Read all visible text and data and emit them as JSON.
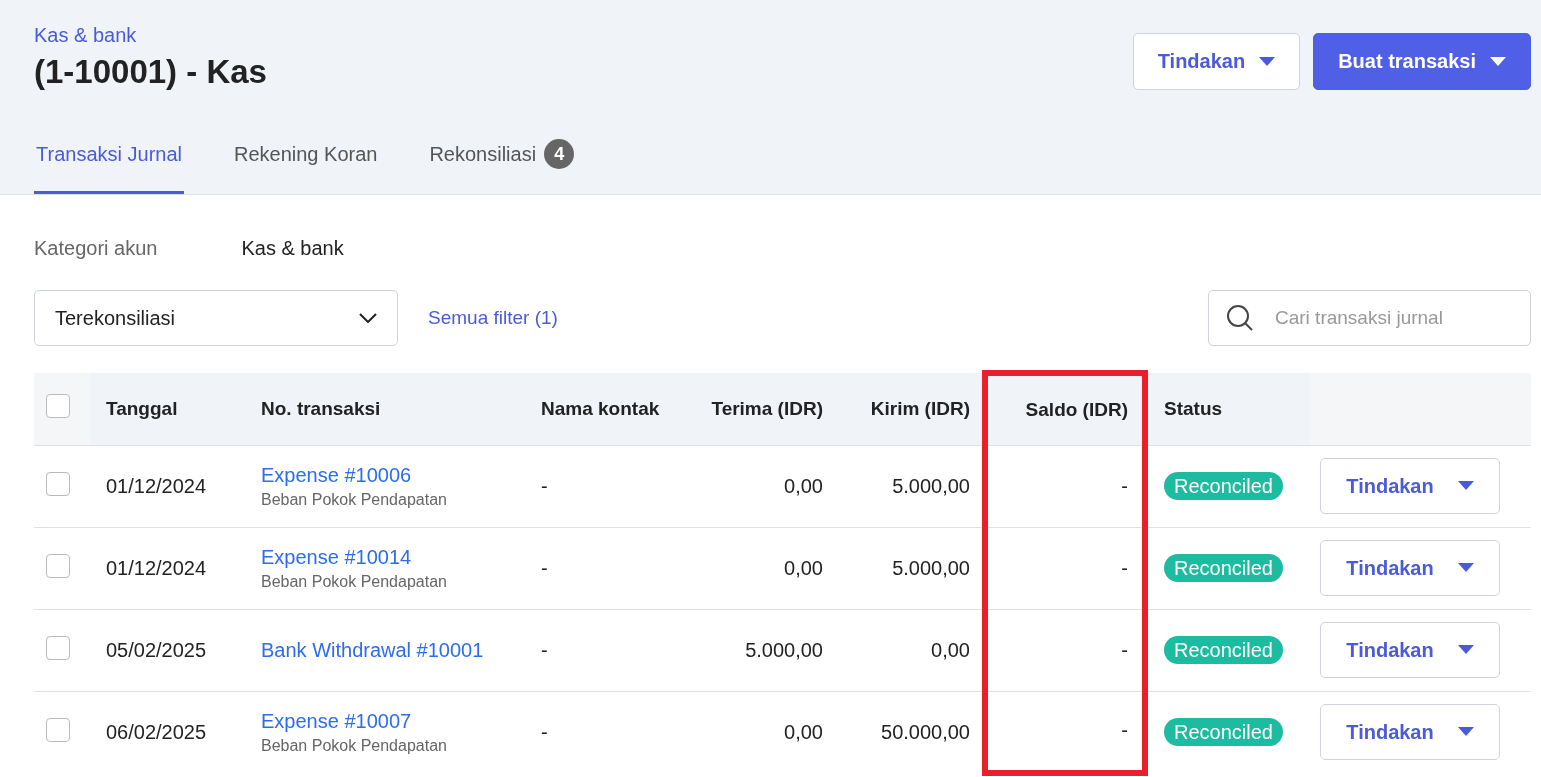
{
  "breadcrumb": "Kas & bank",
  "title": "(1-10001) - Kas",
  "header_buttons": [
    {
      "label": "Tindakan",
      "kind": "secondary"
    },
    {
      "label": "Buat transaksi",
      "kind": "primary"
    }
  ],
  "tabs": [
    {
      "label": "Transaksi Jurnal",
      "selected": true
    },
    {
      "label": "Rekening Koran",
      "selected": false
    },
    {
      "label": "Rekonsiliasi",
      "selected": false,
      "badge": "4"
    }
  ],
  "account_category": {
    "label": "Kategori akun",
    "value": "Kas & bank"
  },
  "filter": {
    "value": "Terekonsiliasi",
    "link": "Semua filter (1)"
  },
  "search": {
    "placeholder": "Cari transaksi jurnal"
  },
  "table": {
    "select_all_checked": false,
    "columns": [
      {
        "label": "Tanggal",
        "highlighted": false
      },
      {
        "label": "No. transaksi",
        "highlighted": false
      },
      {
        "label": "Nama kontak",
        "highlighted": false
      },
      {
        "label": "Terima (IDR)",
        "highlighted": false
      },
      {
        "label": "Kirim (IDR)",
        "highlighted": false
      },
      {
        "label": "Saldo (IDR)",
        "highlighted": true
      },
      {
        "label": "Status",
        "highlighted": false
      }
    ],
    "rows": [
      {
        "checked": false,
        "date": "01/12/2024",
        "number": "Expense #10006",
        "account": "Beban Pokok Pendapatan",
        "contact": "-",
        "receive": "0,00",
        "send": "5.000,00",
        "balance": "-",
        "status": "Reconciled",
        "action": "Tindakan"
      },
      {
        "checked": false,
        "date": "01/12/2024",
        "number": "Expense #10014",
        "account": "Beban Pokok Pendapatan",
        "contact": "-",
        "receive": "0,00",
        "send": "5.000,00",
        "balance": "-",
        "status": "Reconciled",
        "action": "Tindakan"
      },
      {
        "checked": false,
        "date": "05/02/2025",
        "number": "Bank Withdrawal #10001",
        "contact": "-",
        "receive": "5.000,00",
        "send": "0,00",
        "balance": "-",
        "status": "Reconciled",
        "action": "Tindakan"
      },
      {
        "checked": false,
        "date": "06/02/2025",
        "number": "Expense #10007",
        "account": "Beban Pokok Pendapatan",
        "contact": "-",
        "receive": "0,00",
        "send": "50.000,00",
        "balance": "-",
        "status": "Reconciled",
        "action": "Tindakan"
      }
    ]
  }
}
